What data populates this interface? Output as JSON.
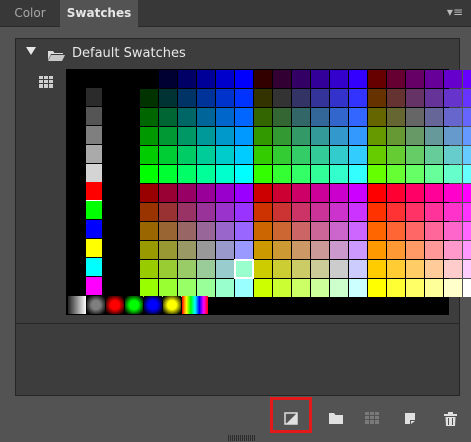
{
  "tabs": {
    "color_label": "Color",
    "swatches_label": "Swatches"
  },
  "panel_menu_icon": "panel-menu-icon",
  "group": {
    "label": "Default Swatches",
    "expanded": true
  },
  "toolbar": {
    "buttons": [
      "new-swatch",
      "new-group",
      "show-grid",
      "load-swatches",
      "delete"
    ],
    "highlighted": "new-swatch"
  },
  "swatch_grid": {
    "grays": [
      "#2b2b2b",
      "#555555",
      "#7f7f7f",
      "#aaaaaa",
      "#d4d4d4",
      "#ffffff"
    ],
    "primaries": [
      "#ff0000",
      "#00ff00",
      "#0000ff",
      "#ffff00",
      "#00ffff",
      "#ff00ff"
    ],
    "r_levels": [
      0,
      0.2,
      0.4,
      0.6,
      0.8,
      1.0
    ],
    "g_levels": [
      0,
      0.2,
      0.4,
      0.6,
      0.8,
      1.0
    ],
    "b_levels": [
      0,
      0.2,
      0.4,
      0.6,
      0.8,
      1.0
    ],
    "selected_swatch": "#99ffcc",
    "gradient_colors": [
      "#ffffff",
      "#7f7f7f",
      "#ff0000",
      "#00ff00",
      "#0000ff",
      "#ffff00"
    ]
  }
}
